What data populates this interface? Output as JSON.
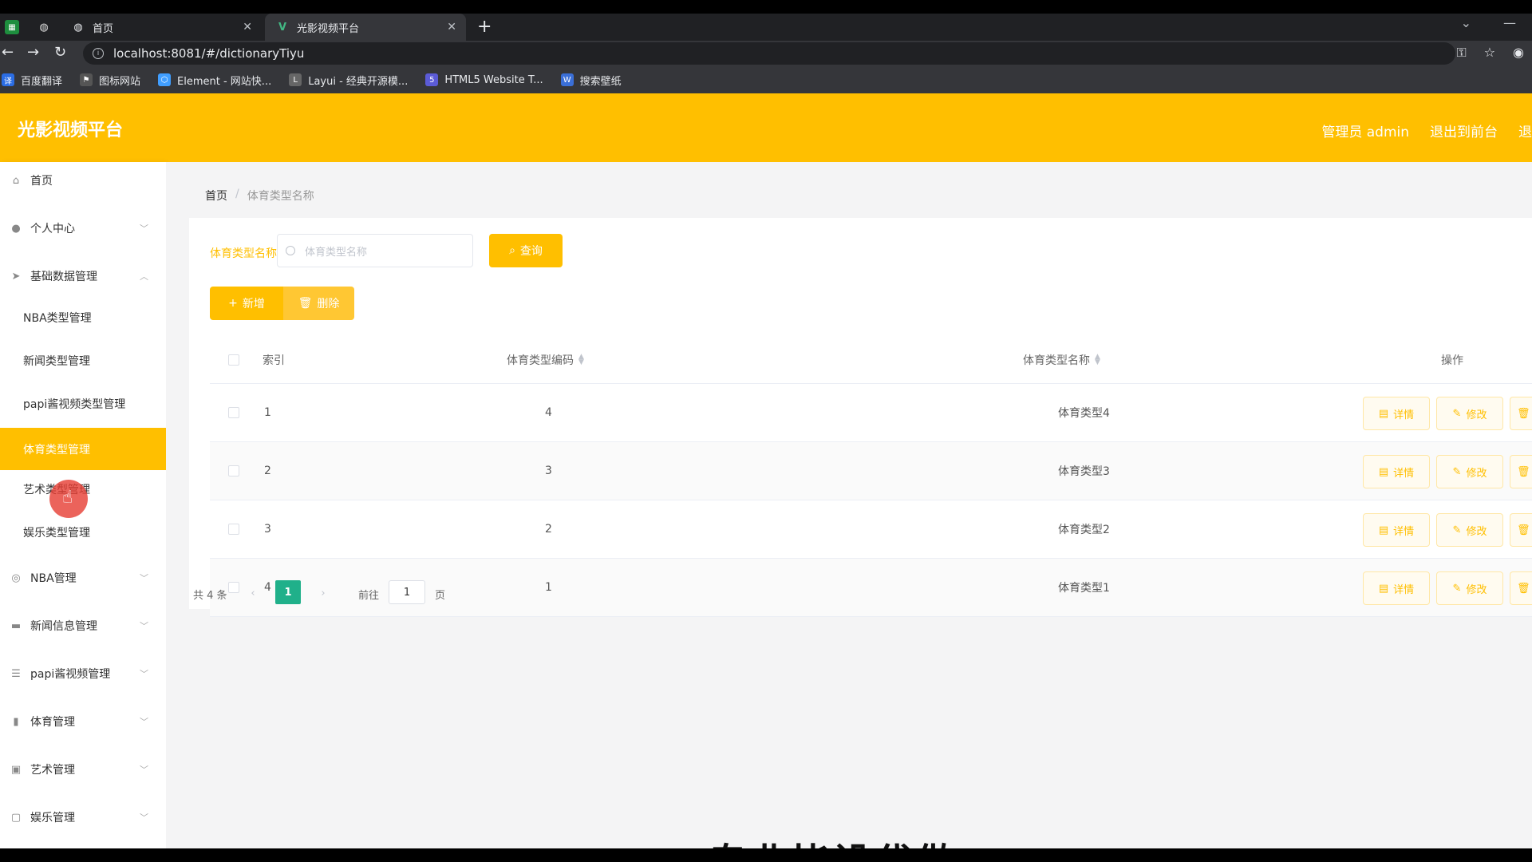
{
  "browser": {
    "tabs": [
      {
        "label": "首页"
      },
      {
        "label": "光影视频平台"
      }
    ],
    "url": "localhost:8081/#/dictionaryTiyu",
    "bookmarks": [
      {
        "label": "百度翻译",
        "color": "#2b6de4"
      },
      {
        "label": "图标网站",
        "color": "#555555"
      },
      {
        "label": "Element - 网站快...",
        "color": "#409eff"
      },
      {
        "label": "Layui - 经典开源模...",
        "color": "#666666"
      },
      {
        "label": "HTML5 Website T...",
        "color": "#5b5bd6"
      },
      {
        "label": "搜索壁纸",
        "color": "#3a6fd8"
      }
    ]
  },
  "header": {
    "title": "光影视频平台",
    "admin": "管理员 admin",
    "back_front": "退出到前台",
    "logout": "退"
  },
  "sidebar": {
    "home": "首页",
    "personal": "个人中心",
    "basic": "基础数据管理",
    "sub_items": [
      "NBA类型管理",
      "新闻类型管理",
      "papi酱视频类型管理",
      "体育类型管理",
      "艺术类型管理",
      "娱乐类型管理"
    ],
    "groups": [
      "NBA管理",
      "新闻信息管理",
      "papi酱视频管理",
      "体育管理",
      "艺术管理",
      "娱乐管理"
    ]
  },
  "breadcrumb": {
    "home": "首页",
    "current": "体育类型名称"
  },
  "search": {
    "label": "体育类型名称",
    "placeholder": "体育类型名称",
    "query": "查询"
  },
  "actions": {
    "add": "新增",
    "delete": "删除"
  },
  "table": {
    "headers": {
      "index": "索引",
      "code": "体育类型编码",
      "name": "体育类型名称",
      "ops": "操作"
    },
    "rows": [
      {
        "index": "1",
        "code": "4",
        "name": "体育类型4"
      },
      {
        "index": "2",
        "code": "3",
        "name": "体育类型3"
      },
      {
        "index": "3",
        "code": "2",
        "name": "体育类型2"
      },
      {
        "index": "4",
        "code": "1",
        "name": "体育类型1"
      }
    ],
    "op_labels": {
      "detail": "详情",
      "edit": "修改",
      "delete": "删除"
    }
  },
  "pager": {
    "total": "共 4 条",
    "current": "1",
    "goto": "前往",
    "page_input": "1",
    "unit": "页"
  },
  "overlay": "专业毕设代做",
  "colors": {
    "accent": "#ffbf00",
    "pager_active": "#20b08a"
  }
}
